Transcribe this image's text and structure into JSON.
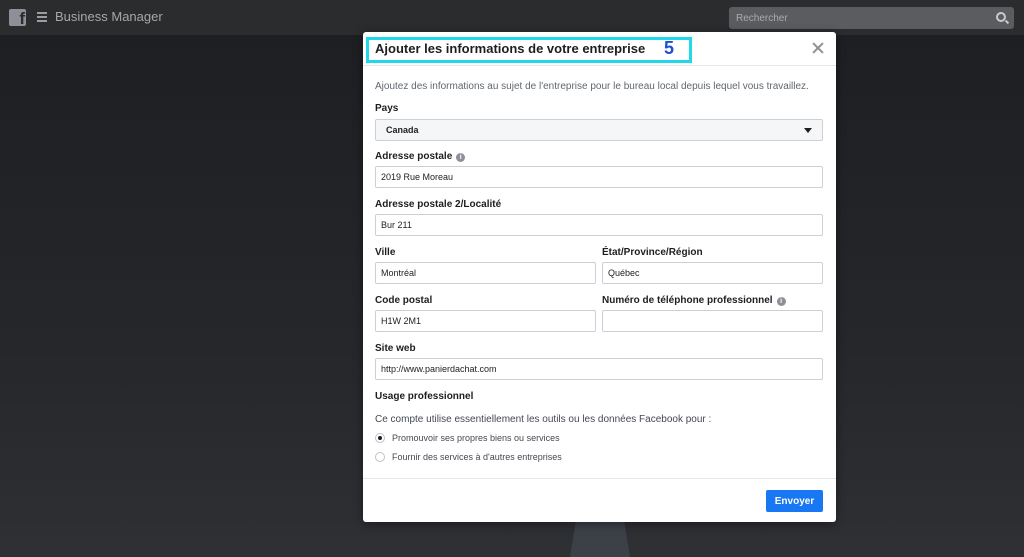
{
  "topbar": {
    "app_title": "Business Manager",
    "search_placeholder": "Rechercher"
  },
  "modal": {
    "title": "Ajouter les informations de votre entreprise",
    "step_number": "5",
    "description": "Ajoutez des informations au sujet de l'entreprise pour le bureau local depuis lequel vous travaillez.",
    "fields": {
      "country": {
        "label": "Pays",
        "value": "Canada"
      },
      "address": {
        "label": "Adresse postale",
        "value": "2019 Rue Moreau"
      },
      "address2": {
        "label": "Adresse postale 2/Localité",
        "value": "Bur 211"
      },
      "city": {
        "label": "Ville",
        "value": "Montréal"
      },
      "state": {
        "label": "État/Province/Région",
        "value": "Québec"
      },
      "postal_code": {
        "label": "Code postal",
        "value": "H1W 2M1"
      },
      "phone": {
        "label": "Numéro de téléphone professionnel",
        "value": ""
      },
      "website": {
        "label": "Site web",
        "value": "http://www.panierdachat.com"
      }
    },
    "usage": {
      "label": "Usage professionnel",
      "question": "Ce compte utilise essentiellement les outils ou les données Facebook pour :",
      "options": [
        {
          "label": "Promouvoir ses propres biens ou services",
          "selected": true
        },
        {
          "label": "Fournir des services à d'autres entreprises",
          "selected": false
        }
      ]
    },
    "submit_label": "Envoyer"
  },
  "colors": {
    "accent": "#1877f2",
    "highlight": "#1fd9e8",
    "step_number": "#1e4fd6"
  }
}
